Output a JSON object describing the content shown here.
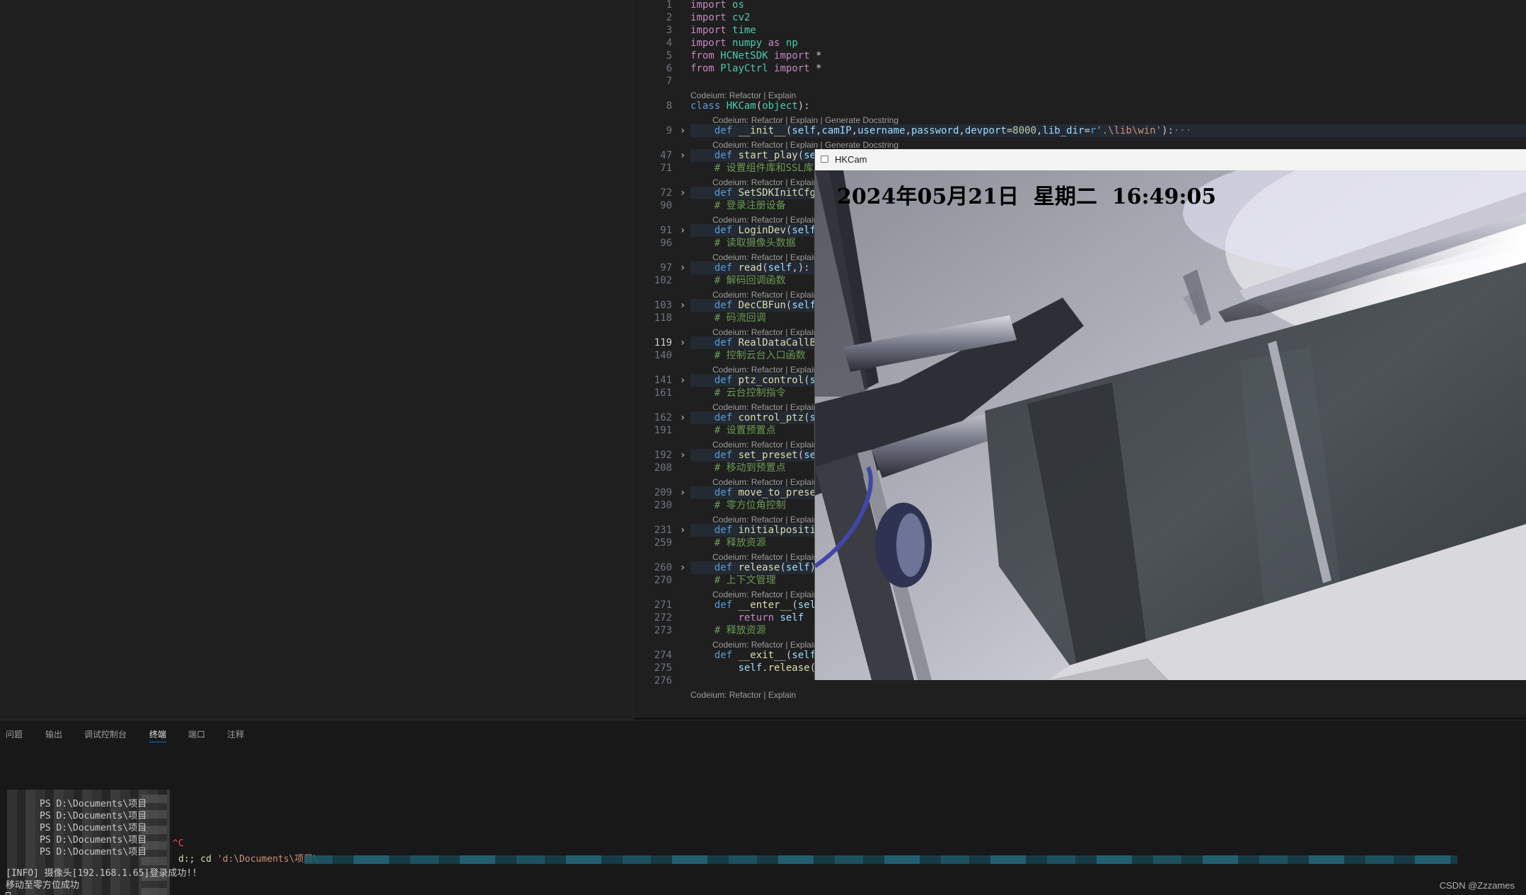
{
  "editor": {
    "lines": [
      {
        "n": "1",
        "parts": [
          [
            "kw",
            "import"
          ],
          [
            "sym",
            " "
          ],
          [
            "mod",
            "os"
          ]
        ]
      },
      {
        "n": "2",
        "parts": [
          [
            "kw",
            "import"
          ],
          [
            "sym",
            " "
          ],
          [
            "mod",
            "cv2"
          ]
        ]
      },
      {
        "n": "3",
        "parts": [
          [
            "kw",
            "import"
          ],
          [
            "sym",
            " "
          ],
          [
            "mod",
            "time"
          ]
        ]
      },
      {
        "n": "4",
        "parts": [
          [
            "kw",
            "import"
          ],
          [
            "sym",
            " "
          ],
          [
            "mod",
            "numpy"
          ],
          [
            "sym",
            " "
          ],
          [
            "kw",
            "as"
          ],
          [
            "sym",
            " "
          ],
          [
            "mod",
            "np"
          ]
        ]
      },
      {
        "n": "5",
        "parts": [
          [
            "kw",
            "from"
          ],
          [
            "sym",
            " "
          ],
          [
            "mod",
            "HCNetSDK"
          ],
          [
            "sym",
            " "
          ],
          [
            "kw",
            "import"
          ],
          [
            "sym",
            " *"
          ]
        ]
      },
      {
        "n": "6",
        "parts": [
          [
            "kw",
            "from"
          ],
          [
            "sym",
            " "
          ],
          [
            "mod",
            "PlayCtrl"
          ],
          [
            "sym",
            " "
          ],
          [
            "kw",
            "import"
          ],
          [
            "sym",
            " *"
          ]
        ]
      },
      {
        "n": "7",
        "parts": []
      },
      {
        "lens": "Codeium: Refactor | Explain",
        "indent": 0
      },
      {
        "n": "8",
        "parts": [
          [
            "def",
            "class"
          ],
          [
            "sym",
            " "
          ],
          [
            "cls",
            "HKCam"
          ],
          [
            "sym",
            "("
          ],
          [
            "cls",
            "object"
          ],
          [
            "sym",
            "):"
          ]
        ]
      },
      {
        "lens": "Codeium: Refactor | Explain | Generate Docstring",
        "indent": 1
      },
      {
        "n": "9",
        "fold": true,
        "hl": true,
        "parts": [
          [
            "sym",
            "    "
          ],
          [
            "def",
            "def"
          ],
          [
            "sym",
            " "
          ],
          [
            "fn",
            "__init__"
          ],
          [
            "sym",
            "("
          ],
          [
            "par",
            "self"
          ],
          [
            "sym",
            ","
          ],
          [
            "par",
            "camIP"
          ],
          [
            "sym",
            ","
          ],
          [
            "par",
            "username"
          ],
          [
            "sym",
            ","
          ],
          [
            "par",
            "password"
          ],
          [
            "sym",
            ","
          ],
          [
            "par",
            "devport"
          ],
          [
            "sym",
            "="
          ],
          [
            "num",
            "8000"
          ],
          [
            "sym",
            ","
          ],
          [
            "par",
            "lib_dir"
          ],
          [
            "sym",
            "="
          ],
          [
            "def",
            "r"
          ],
          [
            "str",
            "'.\\lib\\win'"
          ],
          [
            "sym",
            "):"
          ],
          [
            "ell",
            "···"
          ]
        ]
      },
      {
        "lens": "Codeium: Refactor | Explain | Generate Docstring",
        "indent": 1
      },
      {
        "n": "47",
        "fold": true,
        "hl": true,
        "parts": [
          [
            "sym",
            "    "
          ],
          [
            "def",
            "def"
          ],
          [
            "sym",
            " "
          ],
          [
            "fn",
            "start_play"
          ],
          [
            "sym",
            "("
          ],
          [
            "par",
            "self"
          ]
        ]
      },
      {
        "n": "71",
        "parts": [
          [
            "sym",
            "    "
          ],
          [
            "cmt",
            "# 设置组件库和SSL库加"
          ]
        ]
      },
      {
        "lens": "Codeium: Refactor | Explain",
        "indent": 1
      },
      {
        "n": "72",
        "fold": true,
        "hl": true,
        "parts": [
          [
            "sym",
            "    "
          ],
          [
            "def",
            "def"
          ],
          [
            "sym",
            " "
          ],
          [
            "fn",
            "SetSDKInitCfg"
          ],
          [
            "sym",
            "("
          ],
          [
            "par",
            "s"
          ]
        ]
      },
      {
        "n": "90",
        "parts": [
          [
            "sym",
            "    "
          ],
          [
            "cmt",
            "# 登录注册设备"
          ]
        ]
      },
      {
        "lens": "Codeium: Refactor | Explain",
        "indent": 1
      },
      {
        "n": "91",
        "fold": true,
        "hl": true,
        "parts": [
          [
            "sym",
            "    "
          ],
          [
            "def",
            "def"
          ],
          [
            "sym",
            " "
          ],
          [
            "fn",
            "LoginDev"
          ],
          [
            "sym",
            "("
          ],
          [
            "par",
            "self"
          ],
          [
            "sym",
            ",)"
          ]
        ]
      },
      {
        "n": "96",
        "parts": [
          [
            "sym",
            "    "
          ],
          [
            "cmt",
            "# 读取摄像头数据"
          ]
        ]
      },
      {
        "lens": "Codeium: Refactor | Explain",
        "indent": 1
      },
      {
        "n": "97",
        "fold": true,
        "hl": true,
        "parts": [
          [
            "sym",
            "    "
          ],
          [
            "def",
            "def"
          ],
          [
            "sym",
            " "
          ],
          [
            "fn",
            "read"
          ],
          [
            "sym",
            "("
          ],
          [
            "par",
            "self"
          ],
          [
            "sym",
            ",):"
          ],
          [
            "ell",
            " ···"
          ]
        ]
      },
      {
        "n": "102",
        "parts": [
          [
            "sym",
            "    "
          ],
          [
            "cmt",
            "# 解码回调函数"
          ]
        ]
      },
      {
        "lens": "Codeium: Refactor | Explain",
        "indent": 1
      },
      {
        "n": "103",
        "fold": true,
        "hl": true,
        "parts": [
          [
            "sym",
            "    "
          ],
          [
            "def",
            "def"
          ],
          [
            "sym",
            " "
          ],
          [
            "fn",
            "DecCBFun"
          ],
          [
            "sym",
            "("
          ],
          [
            "par",
            "self"
          ],
          [
            "sym",
            ","
          ],
          [
            "par",
            "n"
          ]
        ]
      },
      {
        "n": "118",
        "parts": [
          [
            "sym",
            "    "
          ],
          [
            "cmt",
            "# 码流回调"
          ]
        ]
      },
      {
        "lens": "Codeium: Refactor | Explain",
        "indent": 1
      },
      {
        "n": "119",
        "fold": true,
        "hl": true,
        "active": true,
        "parts": [
          [
            "sym",
            "    "
          ],
          [
            "def",
            "def"
          ],
          [
            "sym",
            " "
          ],
          [
            "fn",
            "RealDataCallBac"
          ]
        ]
      },
      {
        "n": "140",
        "parts": [
          [
            "sym",
            "    "
          ],
          [
            "cmt",
            "# 控制云台入口函数"
          ]
        ]
      },
      {
        "lens": "Codeium: Refactor | Explain",
        "indent": 1
      },
      {
        "n": "141",
        "fold": true,
        "hl": true,
        "parts": [
          [
            "sym",
            "    "
          ],
          [
            "def",
            "def"
          ],
          [
            "sym",
            " "
          ],
          [
            "fn",
            "ptz_control"
          ],
          [
            "sym",
            "("
          ],
          [
            "par",
            "sel"
          ]
        ]
      },
      {
        "n": "161",
        "parts": [
          [
            "sym",
            "    "
          ],
          [
            "cmt",
            "# 云台控制指令"
          ]
        ]
      },
      {
        "lens": "Codeium: Refactor | Explain",
        "indent": 1
      },
      {
        "n": "162",
        "fold": true,
        "hl": true,
        "parts": [
          [
            "sym",
            "    "
          ],
          [
            "def",
            "def"
          ],
          [
            "sym",
            " "
          ],
          [
            "fn",
            "control_ptz"
          ],
          [
            "sym",
            "("
          ],
          [
            "par",
            "sel"
          ]
        ]
      },
      {
        "n": "191",
        "parts": [
          [
            "sym",
            "    "
          ],
          [
            "cmt",
            "# 设置预置点"
          ]
        ]
      },
      {
        "lens": "Codeium: Refactor | Explain",
        "indent": 1
      },
      {
        "n": "192",
        "fold": true,
        "hl": true,
        "parts": [
          [
            "sym",
            "    "
          ],
          [
            "def",
            "def"
          ],
          [
            "sym",
            " "
          ],
          [
            "fn",
            "set_preset"
          ],
          [
            "sym",
            "("
          ],
          [
            "par",
            "self"
          ]
        ]
      },
      {
        "n": "208",
        "parts": [
          [
            "sym",
            "    "
          ],
          [
            "cmt",
            "# 移动到预置点"
          ]
        ]
      },
      {
        "lens": "Codeium: Refactor | Explain",
        "indent": 1
      },
      {
        "n": "209",
        "fold": true,
        "hl": true,
        "parts": [
          [
            "sym",
            "    "
          ],
          [
            "def",
            "def"
          ],
          [
            "sym",
            " "
          ],
          [
            "fn",
            "move_to_preset"
          ],
          [
            "sym",
            "("
          ]
        ]
      },
      {
        "n": "230",
        "parts": [
          [
            "sym",
            "    "
          ],
          [
            "cmt",
            "# 零方位角控制"
          ]
        ]
      },
      {
        "lens": "Codeium: Refactor | Explain",
        "indent": 1
      },
      {
        "n": "231",
        "fold": true,
        "hl": true,
        "parts": [
          [
            "sym",
            "    "
          ],
          [
            "def",
            "def"
          ],
          [
            "sym",
            " "
          ],
          [
            "fn",
            "initialposition"
          ]
        ]
      },
      {
        "n": "259",
        "parts": [
          [
            "sym",
            "    "
          ],
          [
            "cmt",
            "# 释放资源"
          ]
        ]
      },
      {
        "lens": "Codeium: Refactor | Explain",
        "indent": 1
      },
      {
        "n": "260",
        "fold": true,
        "hl": true,
        "parts": [
          [
            "sym",
            "    "
          ],
          [
            "def",
            "def"
          ],
          [
            "sym",
            " "
          ],
          [
            "fn",
            "release"
          ],
          [
            "sym",
            "("
          ],
          [
            "par",
            "self"
          ],
          [
            "sym",
            "):"
          ]
        ]
      },
      {
        "n": "270",
        "parts": [
          [
            "sym",
            "    "
          ],
          [
            "cmt",
            "# 上下文管理"
          ]
        ]
      },
      {
        "lens": "Codeium: Refactor | Explain",
        "indent": 1
      },
      {
        "n": "271",
        "parts": [
          [
            "sym",
            "    "
          ],
          [
            "def",
            "def"
          ],
          [
            "sym",
            " "
          ],
          [
            "fn",
            "__enter__"
          ],
          [
            "sym",
            "("
          ],
          [
            "par",
            "self"
          ],
          [
            "sym",
            ")"
          ]
        ]
      },
      {
        "n": "272",
        "parts": [
          [
            "sym",
            "        "
          ],
          [
            "kw",
            "return"
          ],
          [
            "sym",
            " "
          ],
          [
            "par",
            "self"
          ]
        ]
      },
      {
        "n": "273",
        "parts": [
          [
            "sym",
            "    "
          ],
          [
            "cmt",
            "# 释放资源"
          ]
        ]
      },
      {
        "lens": "Codeium: Refactor | Explain",
        "indent": 1
      },
      {
        "n": "274",
        "parts": [
          [
            "sym",
            "    "
          ],
          [
            "def",
            "def"
          ],
          [
            "sym",
            " "
          ],
          [
            "fn",
            "__exit__"
          ],
          [
            "sym",
            "("
          ],
          [
            "par",
            "self"
          ],
          [
            "sym",
            ","
          ]
        ]
      },
      {
        "n": "275",
        "parts": [
          [
            "sym",
            "        "
          ],
          [
            "par",
            "self"
          ],
          [
            "sym",
            "."
          ],
          [
            "fn",
            "release"
          ],
          [
            "sym",
            "()"
          ]
        ]
      },
      {
        "n": "276",
        "parts": []
      },
      {
        "lens": "Codeium: Refactor | Explain",
        "indent": 0
      }
    ]
  },
  "camera_window": {
    "title": "HKCam",
    "osd_text": "2024年05月21日  星期二  16:49:05"
  },
  "panel": {
    "tabs": [
      "问题",
      "输出",
      "调试控制台",
      "终端",
      "端口",
      "注释"
    ],
    "active_tab": "终端"
  },
  "terminal": {
    "ps_lines": [
      "PS D:\\Documents\\项目",
      "PS D:\\Documents\\项目",
      "PS D:\\Documents\\项目",
      "PS D:\\Documents\\项目",
      "PS D:\\Documents\\项目"
    ],
    "interrupt_text": "^C",
    "cd_prefix": "d:; cd ",
    "cd_path": "'d:\\Documents\\项目\\",
    "info_line": "[INFO] 摄像头[192.168.1.65]登录成功!!",
    "status_line": "移动至零方位成功"
  },
  "watermark": "CSDN @Zzzames",
  "colors": {
    "editor_bg": "#1f1f1f",
    "panel_bg": "#181818",
    "accent": "#0078d4"
  }
}
